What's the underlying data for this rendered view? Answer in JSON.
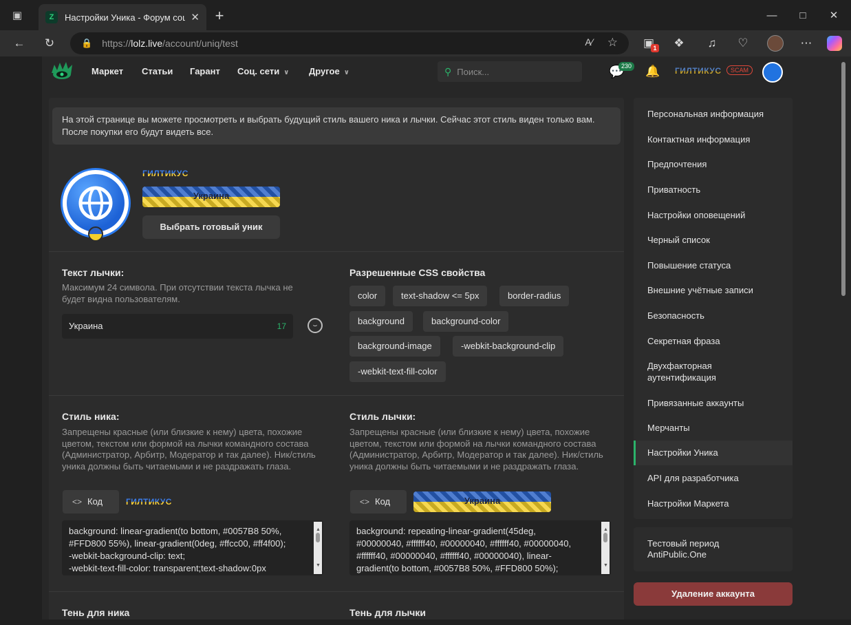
{
  "browser": {
    "tab_title": "Настройки Уника - Форум социальной инженерии",
    "url_host": "lolz.live",
    "url_scheme": "https://",
    "url_path": "/account/uniq/test",
    "notification_count": "1"
  },
  "nav": {
    "items": [
      "Маркет",
      "Статьи",
      "Гарант",
      "Соц. сети",
      "Другое"
    ],
    "search_placeholder": "Поиск...",
    "messages_count": "230",
    "username": "ГИЛТИКУС",
    "scam_badge": "SCAM"
  },
  "notice": "На этой странице вы можете просмотреть и выбрать будущий стиль вашего ника и лычки. Сейчас этот стиль виден только вам. После покупки его будут видеть все.",
  "profile": {
    "username": "ГИЛТИКУС",
    "badge_text": "Украина",
    "choose_button": "Выбрать готовый уник"
  },
  "badge_text_section": {
    "title": "Текст лычки:",
    "description": "Максимум 24 символа. При отсутствии текста лычка не будет видна пользователям.",
    "value": "Украина",
    "remaining": "17"
  },
  "css_section": {
    "title": "Разрешенные CSS свойства",
    "chips": [
      "color",
      "text-shadow <= 5px",
      "border-radius",
      "background",
      "background-color",
      "background-image",
      "-webkit-background-clip",
      "-webkit-text-fill-color"
    ]
  },
  "nick_style": {
    "title": "Стиль ника:",
    "description": "Запрещены красные (или близкие к нему) цвета, похожие цветом, текстом или формой на лычки командного состава (Администратор, Арбитр, Модератор и так далее). Ник/стиль уника должны быть читаемыми и не раздражать глаза.",
    "code_button": "Код",
    "preview": "ГИЛТИКУС",
    "code_lines": [
      "background: linear-gradient(to bottom, #0057B8 50%,",
      "#FFD800 55%), linear-gradient(0deg, #ffcc00, #ff4f00);",
      "    -webkit-background-clip: text;",
      "    -webkit-text-fill-color: transparent;text-shadow:0px"
    ]
  },
  "badge_style": {
    "title": "Стиль лычки:",
    "description": "Запрещены красные (или близкие к нему) цвета, похожие цветом, текстом или формой на лычки командного состава (Администратор, Арбитр, Модератор и так далее). Ник/стиль уника должны быть читаемыми и не раздражать глаза.",
    "code_button": "Код",
    "preview": "Украина",
    "code_lines": [
      "background: repeating-linear-gradient(45deg,",
      "#00000040, #ffffff40, #00000040, #ffffff40, #00000040,",
      "#ffffff40, #00000040, #ffffff40, #00000040),  linear-",
      "gradient(to bottom, #0057B8 50%, #FFD800 50%);"
    ]
  },
  "next_titles": {
    "nick_shadow": "Тень для ника",
    "badge_shadow": "Тень для лычки"
  },
  "sidebar": {
    "items": [
      "Персональная информация",
      "Контактная информация",
      "Предпочтения",
      "Приватность",
      "Настройки оповещений",
      "Черный список",
      "Повышение статуса",
      "Внешние учётные записи",
      "Безопасность",
      "Секретная фраза",
      "Двухфакторная аутентификация",
      "Привязанные аккаунты",
      "Мерчанты",
      "Настройки Уника",
      "API для разработчика",
      "Настройки Маркета"
    ],
    "active_index": 13,
    "trial": "Тестовый период AntiPublic.One",
    "delete_button": "Удаление аккаунта"
  },
  "colors": {
    "accent": "#2bb36a",
    "danger": "#8a3a3a",
    "ukraine_blue": "#0057B8",
    "ukraine_yellow": "#FFD800"
  },
  "icons": [
    "workspaces-icon",
    "forum-favicon",
    "close-icon",
    "plus-icon",
    "minimize-icon",
    "maximize-icon",
    "back-icon",
    "reload-icon",
    "lock-icon",
    "read-aloud-icon",
    "star-icon",
    "extensions-icon",
    "heart-pulse-icon",
    "more-icon",
    "search-icon",
    "messages-icon",
    "bell-icon",
    "smile-icon",
    "code-icon"
  ]
}
